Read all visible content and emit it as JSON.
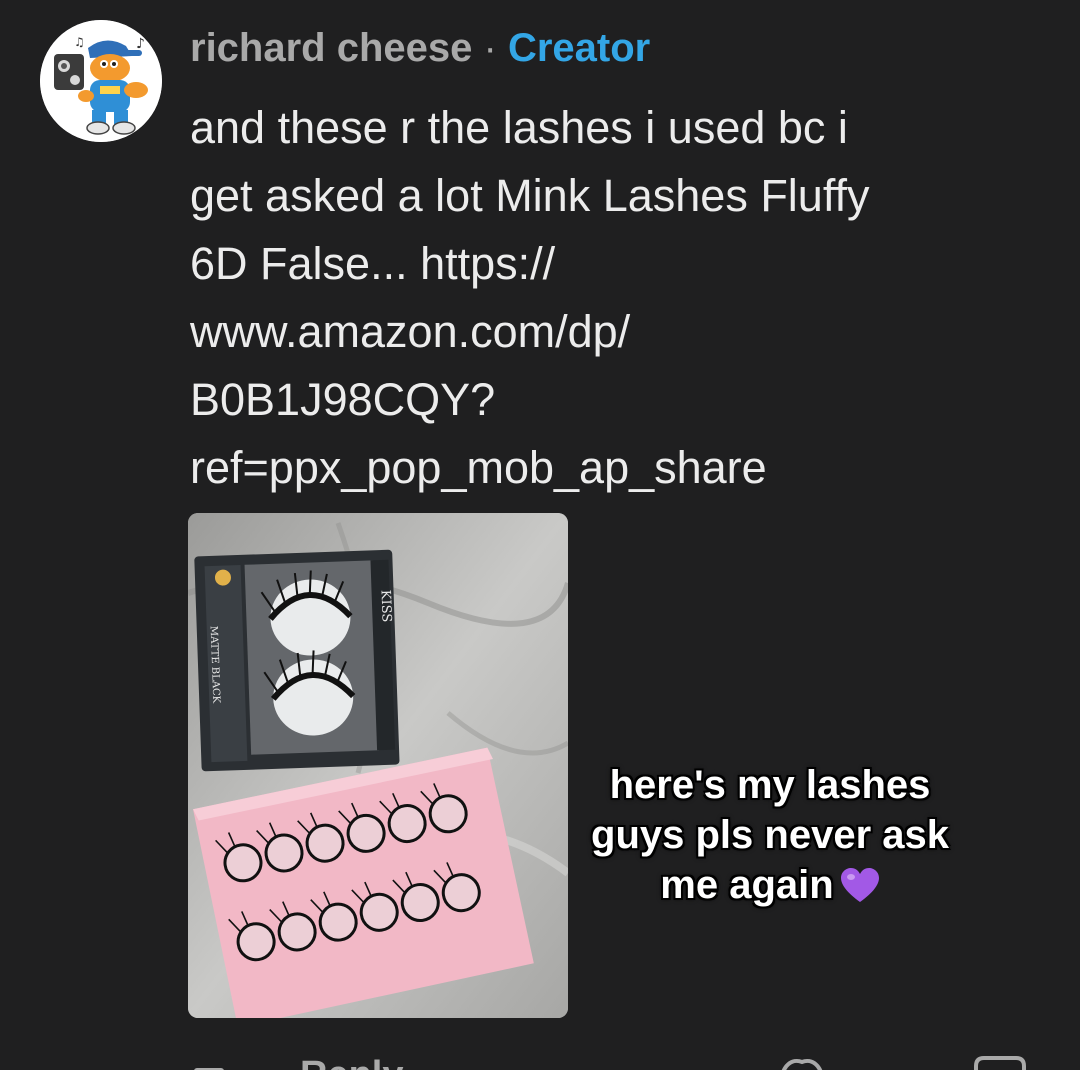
{
  "comment": {
    "username": "richard cheese",
    "separator": "·",
    "badge": "Creator",
    "text": "and these r the lashes i used bc i\nget asked a lot Mink Lashes Fluffy\n6D False... https://\nwww.amazon.com/dp/\nB0B1J98CQY?\nref=ppx_pop_mob_ap_share",
    "overlay_caption": "here's my lashes guys pls never ask me again",
    "overlay_emoji": "purple-heart-icon"
  },
  "footer": {
    "reply_label": "Reply"
  },
  "colors": {
    "background": "#1f1f20",
    "username": "#a9a9a9",
    "creator_badge": "#33a6e6",
    "body_text": "#ececec",
    "purple_heart": "#a259e6",
    "lash_tray": "#f2b8c6"
  }
}
